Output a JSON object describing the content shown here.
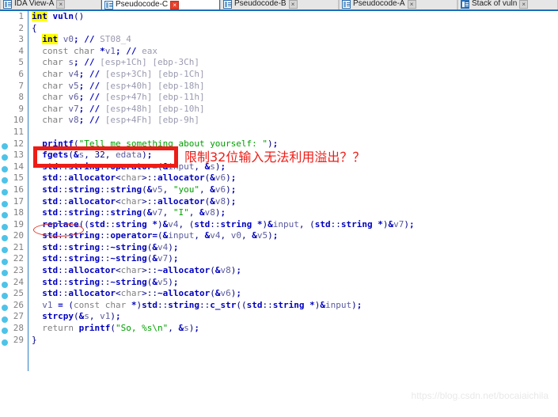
{
  "window": {
    "title": "IDA Pseudocode View",
    "watermark": "https://blog.csdn.net/bocaiaichila"
  },
  "tabs": [
    {
      "label": "IDA View-A",
      "icon": "document-icon",
      "active": false,
      "close_label": "×",
      "close_state": "normal"
    },
    {
      "label": "Pseudocode-C",
      "icon": "document-icon",
      "active": true,
      "close_label": "×",
      "close_state": "warn"
    },
    {
      "label": "Pseudocode-B",
      "icon": "document-icon",
      "active": false,
      "close_label": "×",
      "close_state": "normal"
    },
    {
      "label": "Pseudocode-A",
      "icon": "document-icon",
      "active": false,
      "close_label": "×",
      "close_state": "normal"
    },
    {
      "label": "Stack of vuln",
      "icon": "stack-icon",
      "active": false,
      "close_label": "×",
      "close_state": "normal"
    }
  ],
  "annotations": {
    "chinese_note": "限制32位输入无法利用溢出？？",
    "box_target_line": 13,
    "ellipse_target_line": 19,
    "box_color": "#ee1c16",
    "ellipse_color": "#e0392e"
  },
  "code": {
    "language": "C++ pseudocode",
    "breakpoint_first_line": 12,
    "breakpoint_last_line": 29,
    "lines": [
      {
        "n": 1,
        "text": "int vuln()"
      },
      {
        "n": 2,
        "text": "{"
      },
      {
        "n": 3,
        "text": "  int v0; // ST08_4"
      },
      {
        "n": 4,
        "text": "  const char *v1; // eax"
      },
      {
        "n": 5,
        "text": "  char s; // [esp+1Ch] [ebp-3Ch]"
      },
      {
        "n": 6,
        "text": "  char v4; // [esp+3Ch] [ebp-1Ch]"
      },
      {
        "n": 7,
        "text": "  char v5; // [esp+40h] [ebp-18h]"
      },
      {
        "n": 8,
        "text": "  char v6; // [esp+47h] [ebp-11h]"
      },
      {
        "n": 9,
        "text": "  char v7; // [esp+48h] [ebp-10h]"
      },
      {
        "n": 10,
        "text": "  char v8; // [esp+4Fh] [ebp-9h]"
      },
      {
        "n": 11,
        "text": ""
      },
      {
        "n": 12,
        "text": "  printf(\"Tell me something about yourself: \");"
      },
      {
        "n": 13,
        "text": "  fgets(&s, 32, edata);"
      },
      {
        "n": 14,
        "text": "  std::string::operator=(&input, &s);"
      },
      {
        "n": 15,
        "text": "  std::allocator<char>::allocator(&v6);"
      },
      {
        "n": 16,
        "text": "  std::string::string(&v5, \"you\", &v6);"
      },
      {
        "n": 17,
        "text": "  std::allocator<char>::allocator(&v8);"
      },
      {
        "n": 18,
        "text": "  std::string::string(&v7, \"I\", &v8);"
      },
      {
        "n": 19,
        "text": "  replace((std::string *)&v4, (std::string *)&input, (std::string *)&v7);"
      },
      {
        "n": 20,
        "text": "  std::string::operator=(&input, &v4, v0, &v5);"
      },
      {
        "n": 21,
        "text": "  std::string::~string(&v4);"
      },
      {
        "n": 22,
        "text": "  std::string::~string(&v7);"
      },
      {
        "n": 23,
        "text": "  std::allocator<char>::~allocator(&v8);"
      },
      {
        "n": 24,
        "text": "  std::string::~string(&v5);"
      },
      {
        "n": 25,
        "text": "  std::allocator<char>::~allocator(&v6);"
      },
      {
        "n": 26,
        "text": "  v1 = (const char *)std::string::c_str((std::string *)&input);"
      },
      {
        "n": 27,
        "text": "  strcpy(&s, v1);"
      },
      {
        "n": 28,
        "text": "  return printf(\"So, %s\\n\", &s);"
      },
      {
        "n": 29,
        "text": "}"
      }
    ],
    "highlighted_keyword": "int",
    "colors": {
      "keyword_highlight_bg": "#ffff00",
      "comment": "#9a9ab0",
      "string": "#00a000",
      "function": "#0000c0",
      "identifier": "#404080",
      "breakpoint_dot": "#4ec3e8",
      "guideline": "#2f7fc8",
      "tab_active_border": "#1c6fb8"
    }
  }
}
